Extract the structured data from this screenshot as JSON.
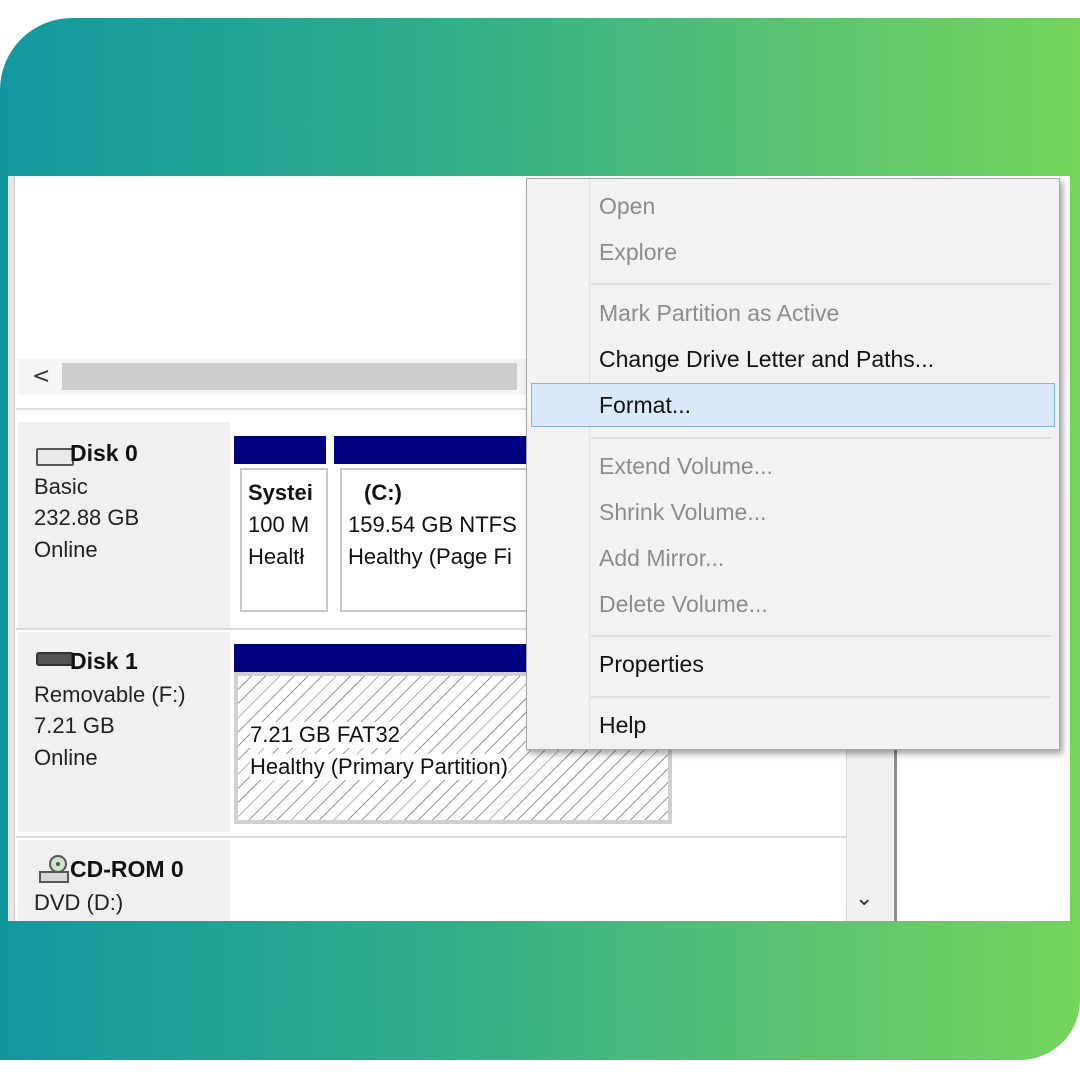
{
  "colors": {
    "frame_gradient_start": "#11989f",
    "frame_gradient_end": "#74d45c",
    "partition_bar": "#000082",
    "menu_highlight": "#d9e9f9",
    "menu_disabled_text": "#8c8c8c"
  },
  "hscroll": {
    "left_arrow": "<"
  },
  "vscroll": {
    "down_arrow": "⌄"
  },
  "disks": [
    {
      "name": "Disk 0",
      "icon": "disk-icon",
      "lines": [
        "Basic",
        "232.88 GB",
        "Online"
      ],
      "partitions": [
        {
          "title": "Systei",
          "line2": "100 M",
          "line3": "Healtł"
        },
        {
          "title": "(C:)",
          "line2": "159.54 GB NTFS",
          "line3": "Healthy (Page Fi"
        }
      ]
    },
    {
      "name": "Disk 1",
      "icon": "removable-disk-icon",
      "lines": [
        "Removable (F:)",
        "7.21 GB",
        "Online"
      ],
      "partitions": [
        {
          "line2": "7.21 GB FAT32",
          "line3": "Healthy (Primary Partition)"
        }
      ]
    },
    {
      "name": "CD-ROM 0",
      "icon": "cd-rom-icon",
      "lines": [
        "DVD (D:)"
      ]
    }
  ],
  "context_menu": {
    "items": [
      {
        "label": "Open",
        "enabled": false
      },
      {
        "label": "Explore",
        "enabled": false
      },
      {
        "label": "Mark Partition as Active",
        "enabled": false
      },
      {
        "label": "Change Drive Letter and Paths...",
        "enabled": true
      },
      {
        "label": "Format...",
        "enabled": true,
        "highlighted": true
      },
      {
        "label": "Extend Volume...",
        "enabled": false
      },
      {
        "label": "Shrink Volume...",
        "enabled": false
      },
      {
        "label": "Add Mirror...",
        "enabled": false
      },
      {
        "label": "Delete Volume...",
        "enabled": false
      },
      {
        "label": "Properties",
        "enabled": true
      },
      {
        "label": "Help",
        "enabled": true
      }
    ]
  }
}
